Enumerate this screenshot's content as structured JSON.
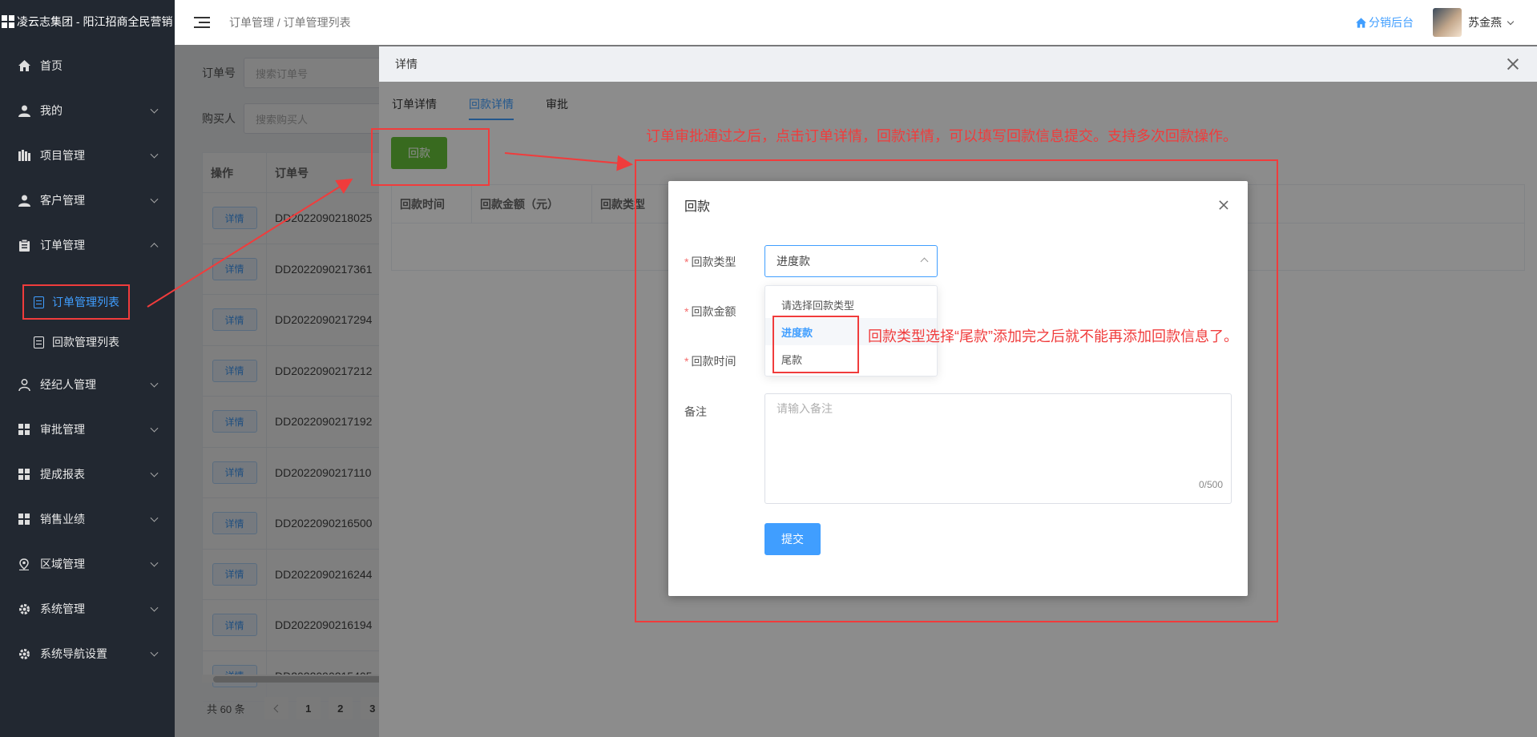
{
  "app": {
    "brand": "凌云志集团 - 阳江招商全民营销"
  },
  "sidebar": {
    "items": [
      {
        "label": "首页",
        "icon": "home-icon"
      },
      {
        "label": "我的",
        "icon": "user-icon"
      },
      {
        "label": "项目管理",
        "icon": "project-icon"
      },
      {
        "label": "客户管理",
        "icon": "customer-icon"
      },
      {
        "label": "订单管理",
        "icon": "clipboard-icon"
      },
      {
        "label": "经纪人管理",
        "icon": "agent-icon"
      },
      {
        "label": "审批管理",
        "icon": "grid-icon"
      },
      {
        "label": "提成报表",
        "icon": "grid-icon"
      },
      {
        "label": "销售业绩",
        "icon": "grid-icon"
      },
      {
        "label": "区域管理",
        "icon": "location-icon"
      },
      {
        "label": "系统管理",
        "icon": "gear-icon"
      },
      {
        "label": "系统导航设置",
        "icon": "gear-icon"
      }
    ],
    "sub_items": [
      {
        "label": "订单管理列表"
      },
      {
        "label": "回款管理列表"
      }
    ]
  },
  "header": {
    "breadcrumb": "订单管理 / 订单管理列表",
    "dist_link": "分销后台",
    "username": "苏金燕"
  },
  "filters": {
    "order_no_label": "订单号",
    "order_no_placeholder": "搜索订单号",
    "buyer_label": "购买人",
    "buyer_placeholder": "搜索购买人"
  },
  "table": {
    "headers": [
      "操作",
      "订单号"
    ],
    "detail_label": "详情",
    "rows": [
      "DD2022090218025",
      "DD2022090217361",
      "DD2022090217294",
      "DD2022090217212",
      "DD2022090217192",
      "DD2022090217110",
      "DD2022090216500",
      "DD2022090216244",
      "DD2022090216194",
      "DD2022090215405"
    ]
  },
  "pager": {
    "total": "共 60 条",
    "pages": [
      "1",
      "2",
      "3"
    ]
  },
  "drawer": {
    "title": "详情",
    "tabs": [
      "订单详情",
      "回款详情",
      "审批"
    ],
    "active_tab": 1,
    "huikuan_button": "回款",
    "table_headers": [
      "回款时间",
      "回款金额（元）",
      "回款类型"
    ]
  },
  "dialog": {
    "title": "回款",
    "type_label": "回款类型",
    "amount_label": "回款金额",
    "time_label": "回款时间",
    "note_label": "备注",
    "selected_value": "进度款",
    "options": [
      "请选择回款类型",
      "进度款",
      "尾款"
    ],
    "note_placeholder": "请输入备注",
    "note_counter": "0/500",
    "submit_label": "提交"
  },
  "annotations": {
    "top_note": "订单审批通过之后，点击订单详情，回款详情，可以填写回款信息提交。支持多次回款操作。",
    "side_note": "回款类型选择“尾款”添加完之后就不能再添加回款信息了。"
  },
  "colors": {
    "sidebar_bg": "#222831",
    "primary": "#409eff",
    "success": "#67c23a",
    "annotation": "#f03c3c"
  }
}
